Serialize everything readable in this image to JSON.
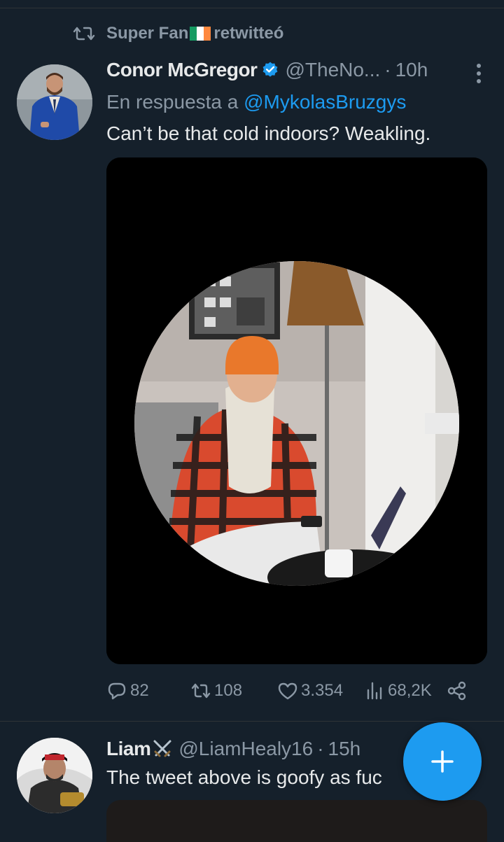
{
  "retweet": {
    "by": "Super Fan",
    "flag_colors": [
      "#169b62",
      "#ffffff",
      "#ff883e"
    ],
    "suffix": "retwitteó"
  },
  "tweet": {
    "author_name": "Conor McGregor",
    "verified_icon": "verified-badge-icon",
    "handle": "@TheNo...",
    "separator": "·",
    "time": "10h",
    "reply_prefix": "En respuesta a",
    "reply_mention": "@MykolasBruzgys",
    "text": "Can’t be that cold indoors? Weakling.",
    "actions": {
      "replies": "82",
      "retweets": "108",
      "likes": "3.354",
      "views": "68,2K"
    }
  },
  "next_tweet": {
    "author_name": "Liam",
    "handle": "@LiamHealy16",
    "separator": "·",
    "time": "15h",
    "text": "The tweet above is goofy as fuc"
  },
  "colors": {
    "background": "#15202b",
    "accent": "#1d9bf0",
    "secondary_text": "#8b98a5"
  }
}
